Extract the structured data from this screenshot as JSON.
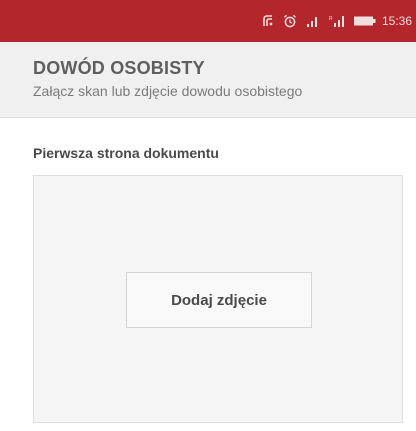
{
  "colors": {
    "status_bar": "#b3262c",
    "header_bg": "#f0f0f0",
    "title_text": "#5f5f5f",
    "upload_bg": "#f6f6f6"
  },
  "status_bar": {
    "icons": [
      "nfc-icon",
      "alarm-icon",
      "signal-icon",
      "signal-roaming-icon",
      "battery-icon"
    ],
    "time": "15:36"
  },
  "header": {
    "title": "DOWÓD OSOBISTY",
    "subtitle": "Załącz skan lub zdjęcie dowodu osobistego"
  },
  "document_section": {
    "label": "Pierwsza strona dokumentu",
    "add_photo_label": "Dodaj zdjęcie"
  }
}
